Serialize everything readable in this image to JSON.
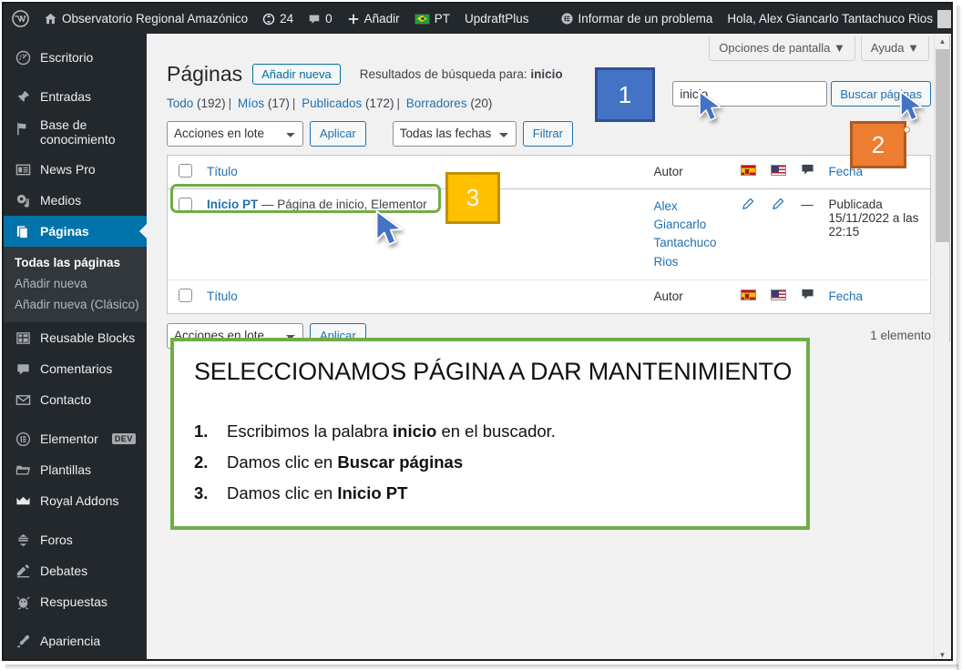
{
  "adminbar": {
    "wp_logo": "wordpress-logo",
    "site_name": "Observatorio Regional Amazónico",
    "updates_count": "24",
    "comments_count": "0",
    "new_label": "Añadir",
    "lang_code": "PT",
    "updraft_label": "UpdraftPlus",
    "report_problem": "Informar de un problema",
    "howdy": "Hola, Alex Giancarlo Tantachuco Rios"
  },
  "sidebar": {
    "items": [
      {
        "label": "Escritorio",
        "icon": "dashboard-icon"
      },
      {
        "label": "Entradas",
        "icon": "pin-icon"
      },
      {
        "label": "Base de conocimiento",
        "icon": "flag-icon"
      },
      {
        "label": "News Pro",
        "icon": "list-card-icon"
      },
      {
        "label": "Medios",
        "icon": "media-icon"
      },
      {
        "label": "Páginas",
        "icon": "pages-icon",
        "current": true
      },
      {
        "label": "Reusable Blocks",
        "icon": "blocks-icon"
      },
      {
        "label": "Comentarios",
        "icon": "comment-icon"
      },
      {
        "label": "Contacto",
        "icon": "mail-icon"
      },
      {
        "label": "Elementor",
        "icon": "elementor-icon",
        "badge": "DEV"
      },
      {
        "label": "Plantillas",
        "icon": "folder-icon"
      },
      {
        "label": "Royal Addons",
        "icon": "crown-icon"
      },
      {
        "label": "Foros",
        "icon": "forums-icon"
      },
      {
        "label": "Debates",
        "icon": "topics-icon"
      },
      {
        "label": "Respuestas",
        "icon": "replies-icon"
      },
      {
        "label": "Apariencia",
        "icon": "appearance-icon"
      }
    ],
    "submenu": [
      {
        "label": "Todas las páginas",
        "active": true
      },
      {
        "label": "Añadir nueva",
        "active": false
      },
      {
        "label": "Añadir nueva (Clásico)",
        "active": false
      }
    ]
  },
  "screen_meta": {
    "screen_options": "Opciones de pantalla ▼",
    "help": "Ayuda ▼"
  },
  "page": {
    "title": "Páginas",
    "add_new": "Añadir nueva",
    "search_results_prefix": "Resultados de búsqueda para:",
    "search_results_term": "inicio"
  },
  "views": [
    {
      "label": "Todo",
      "count": "(192)"
    },
    {
      "label": "Míos",
      "count": "(17)"
    },
    {
      "label": "Publicados",
      "count": "(172)"
    },
    {
      "label": "Borradores",
      "count": "(20)"
    }
  ],
  "tablenav_top": {
    "bulk_selected": "Acciones en lote",
    "apply_label": "Aplicar",
    "dates_selected": "Todas las fechas",
    "filter_label": "Filtrar"
  },
  "search": {
    "value": "inicio",
    "placeholder": "",
    "submit_label": "Buscar páginas"
  },
  "table": {
    "headers": {
      "title": "Título",
      "author": "Autor",
      "flag_es": "spain-flag-icon",
      "flag_us": "usa-flag-icon",
      "comments": "comment-icon",
      "date": "Fecha"
    },
    "rows": [
      {
        "title": "Inicio PT",
        "dash": "—",
        "suffix": "Página de inicio, Elementor",
        "author": "Alex Giancarlo Tantachuco Rios",
        "es_action": "pencil-icon",
        "us_action": "pencil-icon",
        "comments": "—",
        "date_status": "Publicada",
        "date_value": "15/11/2022 a las 22:15"
      }
    ]
  },
  "tablenav_bottom": {
    "bulk_selected": "Acciones en lote",
    "apply_label": "Aplicar",
    "displaying_num": "1 elemento"
  },
  "callouts": [
    {
      "number": "1",
      "color": "#4472c4"
    },
    {
      "number": "2",
      "color": "#ed7d31"
    },
    {
      "number": "3",
      "color": "#ffc000"
    }
  ],
  "instructions": {
    "title": "SELECCIONAMOS PÁGINA A DAR MANTENIMIENTO",
    "steps": [
      {
        "num": "1.",
        "pre": "Escribimos la palabra ",
        "bold": "inicio",
        "post": " en el buscador."
      },
      {
        "num": "2.",
        "pre": "Damos clic en ",
        "bold": "Buscar páginas",
        "post": ""
      },
      {
        "num": "3.",
        "pre": "Damos clic en ",
        "bold": "Inicio PT",
        "post": ""
      }
    ]
  }
}
